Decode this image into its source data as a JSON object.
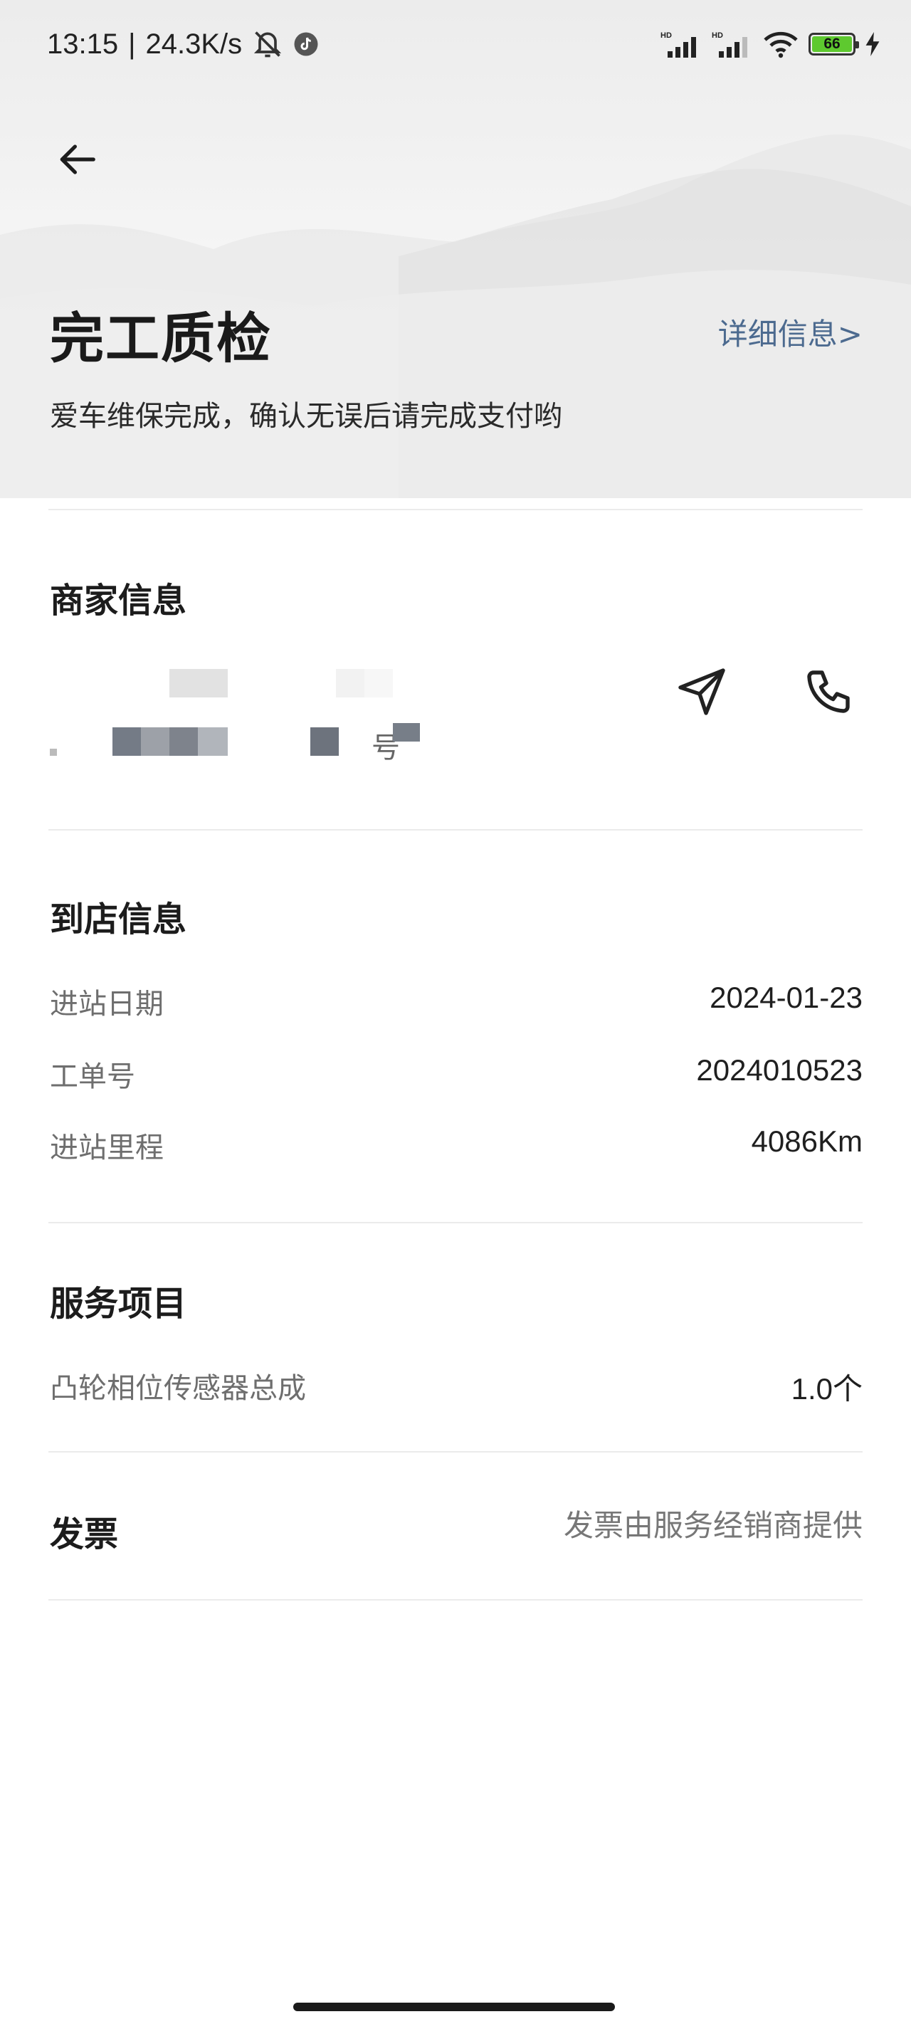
{
  "status_bar": {
    "time": "13:15",
    "separator": "|",
    "network_speed": "24.3K/s",
    "network_tag_1": "HD",
    "network_tag_2": "HD",
    "battery_level": "66",
    "icons": [
      "mute-bell-icon",
      "tiktok-icon",
      "signal-icon",
      "signal-icon",
      "wifi-icon",
      "battery-icon",
      "charging-icon"
    ]
  },
  "header": {
    "back_icon": "arrow-left-icon",
    "title": "完工质检",
    "detail_link": "详细信息>",
    "subtitle": "爱车维保完成，确认无误后请完成支付哟"
  },
  "merchant": {
    "section_title": "商家信息",
    "address_visible_fragment": "号",
    "actions": [
      "navigate-icon",
      "phone-icon"
    ]
  },
  "arrival": {
    "section_title": "到店信息",
    "rows": [
      {
        "label": "进站日期",
        "value": "2024-01-23"
      },
      {
        "label": "工单号",
        "value": "2024010523"
      },
      {
        "label": "进站里程",
        "value": "4086Km"
      }
    ]
  },
  "services": {
    "section_title": "服务项目",
    "items": [
      {
        "name": "凸轮相位传感器总成",
        "quantity": "1.0个"
      }
    ]
  },
  "invoice": {
    "section_title": "发票",
    "value": "发票由服务经销商提供"
  },
  "colors": {
    "accent_link": "#4c6a8f",
    "battery_green": "#5ec92f",
    "divider": "#ebebeb"
  }
}
